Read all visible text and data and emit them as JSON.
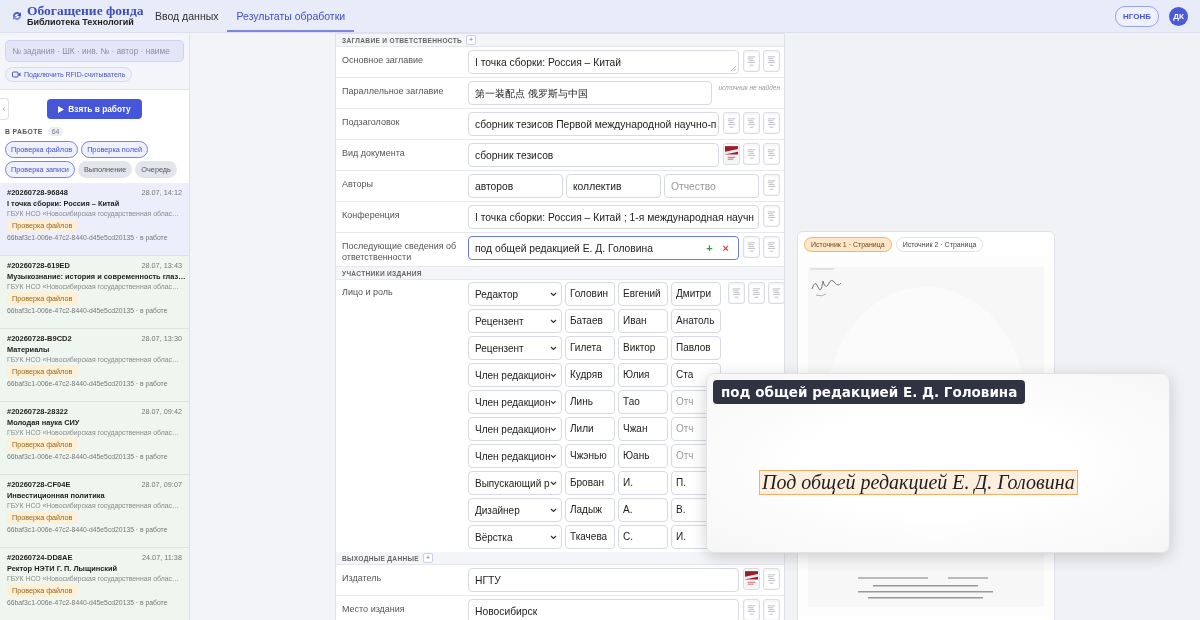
{
  "header": {
    "logo_title": "Обогащение фонда",
    "logo_subtitle": "Библиотека Технологий",
    "nav": [
      {
        "label": "Ввод данных",
        "selected": false
      },
      {
        "label": "Результаты обработки",
        "selected": true
      }
    ],
    "org_button": "НГОНБ",
    "avatar": "ДК"
  },
  "sidebar": {
    "search": {
      "placeholder": "№ задания · ШК · инв. № · автор · наиме"
    },
    "rfid_button": "Подключить RFID-считыватель",
    "collapse_handle": "‹",
    "take_button": "Взять в работу",
    "section": {
      "title": "В РАБОТЕ",
      "count": "64"
    },
    "filters": [
      {
        "label": "Проверка файлов",
        "selected": true
      },
      {
        "label": "Проверка полей",
        "selected": true
      },
      {
        "label": "Проверка записи",
        "selected": true
      },
      {
        "label": "Выполнение",
        "selected": false
      },
      {
        "label": "Очередь",
        "selected": false
      }
    ],
    "tasks": [
      {
        "id": "#20260728-96848",
        "time": "28.07, 14:12",
        "title": "I точка сборки: Россия – Китай",
        "org": "ГБУК НСО «Новосибирская государственная облас…",
        "status": "Проверка файлов",
        "footer": "66baf3c1-006e-47c2-8440-d45e5cd20135 · в работе",
        "selected": true
      },
      {
        "id": "#20260728-619ED",
        "time": "28.07, 13:43",
        "title": "Музыкознание: история и современность глаз…",
        "org": "ГБУК НСО «Новосибирская государственная облас…",
        "status": "Проверка файлов",
        "footer": "66baf3c1-006e-47c2-8440-d45e5cd20135 · в работе",
        "selected": false
      },
      {
        "id": "#20260728-B9CD2",
        "time": "28.07, 13:30",
        "title": "Материалы",
        "org": "ГБУК НСО «Новосибирская государственная облас…",
        "status": "Проверка файлов",
        "footer": "66baf3c1-006e-47c2-8440-d45e5cd20135 · в работе",
        "selected": false
      },
      {
        "id": "#20260728-28322",
        "time": "28.07, 09:42",
        "title": "Молодая наука СИУ",
        "org": "ГБУК НСО «Новосибирская государственная облас…",
        "status": "Проверка файлов",
        "footer": "66baf3c1-006e-47c2-8440-d45e5cd20135 · в работе",
        "selected": false
      },
      {
        "id": "#20260728-CF04E",
        "time": "28.07, 09:07",
        "title": "Инвестиционная политика",
        "org": "ГБУК НСО «Новосибирская государственная облас…",
        "status": "Проверка файлов",
        "footer": "66baf3c1-006e-47c2-8440-d45e5cd20135 · в работе",
        "selected": false
      },
      {
        "id": "#20260724-DD8AE",
        "time": "24.07, 11:38",
        "title": "Ректор НЭТИ Г. П. Лыщинский",
        "org": "ГБУК НСО «Новосибирская государственная облас…",
        "status": "Проверка файлов",
        "footer": "66baf3c1-006e-47c2-8440-d45e5cd20135 · в работе",
        "selected": false
      }
    ]
  },
  "form": {
    "sections": [
      {
        "title": "ЗАГЛАВИЕ И ОТВЕТСТВЕННОСТЬ",
        "add": "+",
        "rows": [
          {
            "kind": "fields",
            "label": "Основное заглавие",
            "fields": [
              {
                "value": "I точка сборки: Россия – Китай",
                "multiline": true
              }
            ],
            "thumbs": [
              {
                "kind": "page"
              },
              {
                "kind": "page"
              }
            ]
          },
          {
            "kind": "fields",
            "label": "Параллельное заглавие",
            "fields": [
              {
                "value": "第一装配点 俄罗斯与中国"
              }
            ],
            "note": "источник не найден"
          },
          {
            "kind": "fields",
            "label": "Подзаголовок",
            "fields": [
              {
                "value": "сборник тезисов Первой международной научно-п"
              }
            ],
            "thumbs": [
              {
                "kind": "page"
              },
              {
                "kind": "page"
              },
              {
                "kind": "page"
              }
            ]
          },
          {
            "kind": "fields",
            "label": "Вид документа",
            "fields": [
              {
                "value": "сборник тезисов"
              }
            ],
            "thumbs": [
              {
                "kind": "cover"
              },
              {
                "kind": "page"
              },
              {
                "kind": "page"
              }
            ]
          },
          {
            "kind": "fields",
            "label": "Авторы",
            "fields": [
              {
                "value": "авторов"
              },
              {
                "value": "коллектив"
              },
              {
                "placeholder": "Отчество"
              }
            ],
            "thumbs": [
              {
                "kind": "page"
              }
            ]
          },
          {
            "kind": "fields",
            "label": "Конференция",
            "fields": [
              {
                "value": "I точка сборки: Россия – Китай ; 1-я международная научн"
              }
            ],
            "thumbs": [
              {
                "kind": "page"
              }
            ]
          },
          {
            "kind": "fields",
            "label": "Последующие сведения об ответственности",
            "fields": [
              {
                "value": "под общей редакцией Е. Д. Головина",
                "focused": true,
                "actions": [
                  "+",
                  "×"
                ]
              }
            ],
            "thumbs": [
              {
                "kind": "page"
              },
              {
                "kind": "page"
              }
            ]
          }
        ]
      },
      {
        "title": "УЧАСТНИКИ ИЗДАНИЯ",
        "rows": [
          {
            "kind": "persons",
            "label": "Лицо и роль",
            "thumbs": [
              {
                "kind": "page"
              },
              {
                "kind": "page"
              },
              {
                "kind": "page"
              }
            ],
            "persons": [
              {
                "role": "Редактор",
                "surname": "Головин",
                "name": "Евгений",
                "patronymic": {
                  "value": "Дмитри"
                }
              },
              {
                "role": "Рецензент",
                "surname": "Батаев",
                "name": "Иван",
                "patronymic": {
                  "value": "Анатоль"
                }
              },
              {
                "role": "Рецензент",
                "surname": "Гилета",
                "name": "Виктор",
                "patronymic": {
                  "value": "Павлов"
                }
              },
              {
                "role": "Член редакцион",
                "surname": "Кудряв",
                "name": "Юлия",
                "patronymic": {
                  "value": "Ста"
                }
              },
              {
                "role": "Член редакцион",
                "surname": "Линь",
                "name": "Тао",
                "patronymic": {
                  "placeholder": "Отч"
                }
              },
              {
                "role": "Член редакцион",
                "surname": "Лили",
                "name": "Чжан",
                "patronymic": {
                  "placeholder": "Отч"
                }
              },
              {
                "role": "Член редакцион",
                "surname": "Чжэнью",
                "name": "Юань",
                "patronymic": {
                  "placeholder": "Отч"
                }
              },
              {
                "role": "Выпускающий р",
                "surname": "Брован",
                "name": "И.",
                "patronymic": {
                  "value": "П."
                }
              },
              {
                "role": "Дизайнер",
                "surname": "Ладыж",
                "name": "А.",
                "patronymic": {
                  "value": "В."
                }
              },
              {
                "role": "Вёрстка",
                "surname": "Ткачева",
                "name": "С.",
                "patronymic": {
                  "value": "И."
                }
              }
            ]
          }
        ]
      },
      {
        "title": "ВЫХОДНЫЕ ДАННЫЕ",
        "add": "+",
        "rows": [
          {
            "kind": "fields",
            "label": "Издатель",
            "fields": [
              {
                "value": "НГТУ"
              }
            ],
            "thumbs": [
              {
                "kind": "cover"
              },
              {
                "kind": "page"
              }
            ]
          },
          {
            "kind": "fields",
            "label": "Место издания",
            "fields": [
              {
                "value": "Новосибирск"
              }
            ],
            "thumbs": [
              {
                "kind": "page"
              },
              {
                "kind": "page"
              }
            ]
          }
        ]
      }
    ]
  },
  "viewer": {
    "tabs": [
      {
        "label": "Источник 1 · Страница",
        "selected": true
      },
      {
        "label": "Источник 2 · Страница",
        "selected": false
      }
    ]
  },
  "magnifier": {
    "caption": "под общей редакцией Е. Д. Головина",
    "scan_text": "Под общей редакцией Е. Д. Головина"
  }
}
